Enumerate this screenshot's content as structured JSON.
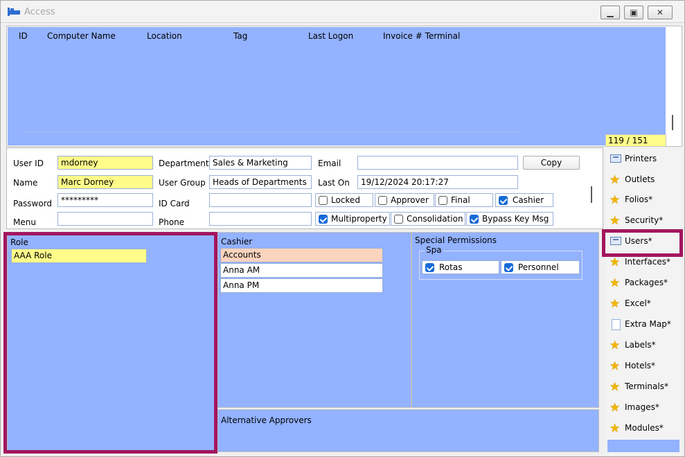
{
  "window": {
    "title": "Access"
  },
  "terminal_grid": {
    "columns": [
      "ID",
      "Computer Name",
      "Location",
      "Tag",
      "Last Logon",
      "Invoice # Terminal"
    ],
    "record_counter": "119 / 151"
  },
  "user_form": {
    "user_id_label": "User ID",
    "user_id": "mdorney",
    "name_label": "Name",
    "name": "Marc Dorney",
    "password_label": "Password",
    "password": "*********",
    "menu_label": "Menu",
    "menu": "",
    "department_label": "Department",
    "department": "Sales & Marketing",
    "user_group_label": "User Group",
    "user_group": "Heads of Departments",
    "id_card_label": "ID Card",
    "id_card": "",
    "phone_label": "Phone",
    "phone": "",
    "email_label": "Email",
    "email": "",
    "last_on_label": "Last On",
    "last_on": "19/12/2024 20:17:27",
    "copy_label": "Copy",
    "checkboxes": {
      "locked": {
        "label": "Locked",
        "checked": false
      },
      "approver": {
        "label": "Approver",
        "checked": false
      },
      "final": {
        "label": "Final",
        "checked": false
      },
      "cashier": {
        "label": "Cashier",
        "checked": true
      },
      "multiproperty": {
        "label": "Multiproperty",
        "checked": true
      },
      "consolidation": {
        "label": "Consolidation",
        "checked": false
      },
      "bypass_key_msg": {
        "label": "Bypass Key Msg",
        "checked": true
      }
    }
  },
  "role_panel": {
    "title": "Role",
    "items": [
      "AAA Role"
    ]
  },
  "cashier_panel": {
    "title": "Cashier",
    "items": [
      "Accounts",
      "Anna AM",
      "Anna PM"
    ]
  },
  "permissions_panel": {
    "title": "Special Permissions",
    "group": "Spa",
    "rotas": {
      "label": "Rotas",
      "checked": true
    },
    "personnel": {
      "label": "Personnel",
      "checked": true
    }
  },
  "approvers_panel": {
    "title": "Alternative Approvers"
  },
  "nav": {
    "items": [
      {
        "label": "Printers",
        "icon": "printer-icon"
      },
      {
        "label": "Outlets",
        "icon": "star-icon"
      },
      {
        "label": "Folios*",
        "icon": "star-icon"
      },
      {
        "label": "Security*",
        "icon": "star-icon"
      },
      {
        "label": "Users*",
        "icon": "printer-icon"
      },
      {
        "label": "Interfaces*",
        "icon": "star-icon"
      },
      {
        "label": "Packages*",
        "icon": "star-icon"
      },
      {
        "label": "Excel*",
        "icon": "star-icon"
      },
      {
        "label": "Extra Map*",
        "icon": "page-icon"
      },
      {
        "label": "Labels*",
        "icon": "star-icon"
      },
      {
        "label": "Hotels*",
        "icon": "star-icon"
      },
      {
        "label": "Terminals*",
        "icon": "star-icon"
      },
      {
        "label": "Images*",
        "icon": "star-icon"
      },
      {
        "label": "Modules*",
        "icon": "star-icon"
      }
    ]
  },
  "colors": {
    "panel_blue": "#93b2ff",
    "field_yellow": "#fffc8a",
    "highlight": "#a3155e",
    "selected_row": "#fbd4be"
  }
}
